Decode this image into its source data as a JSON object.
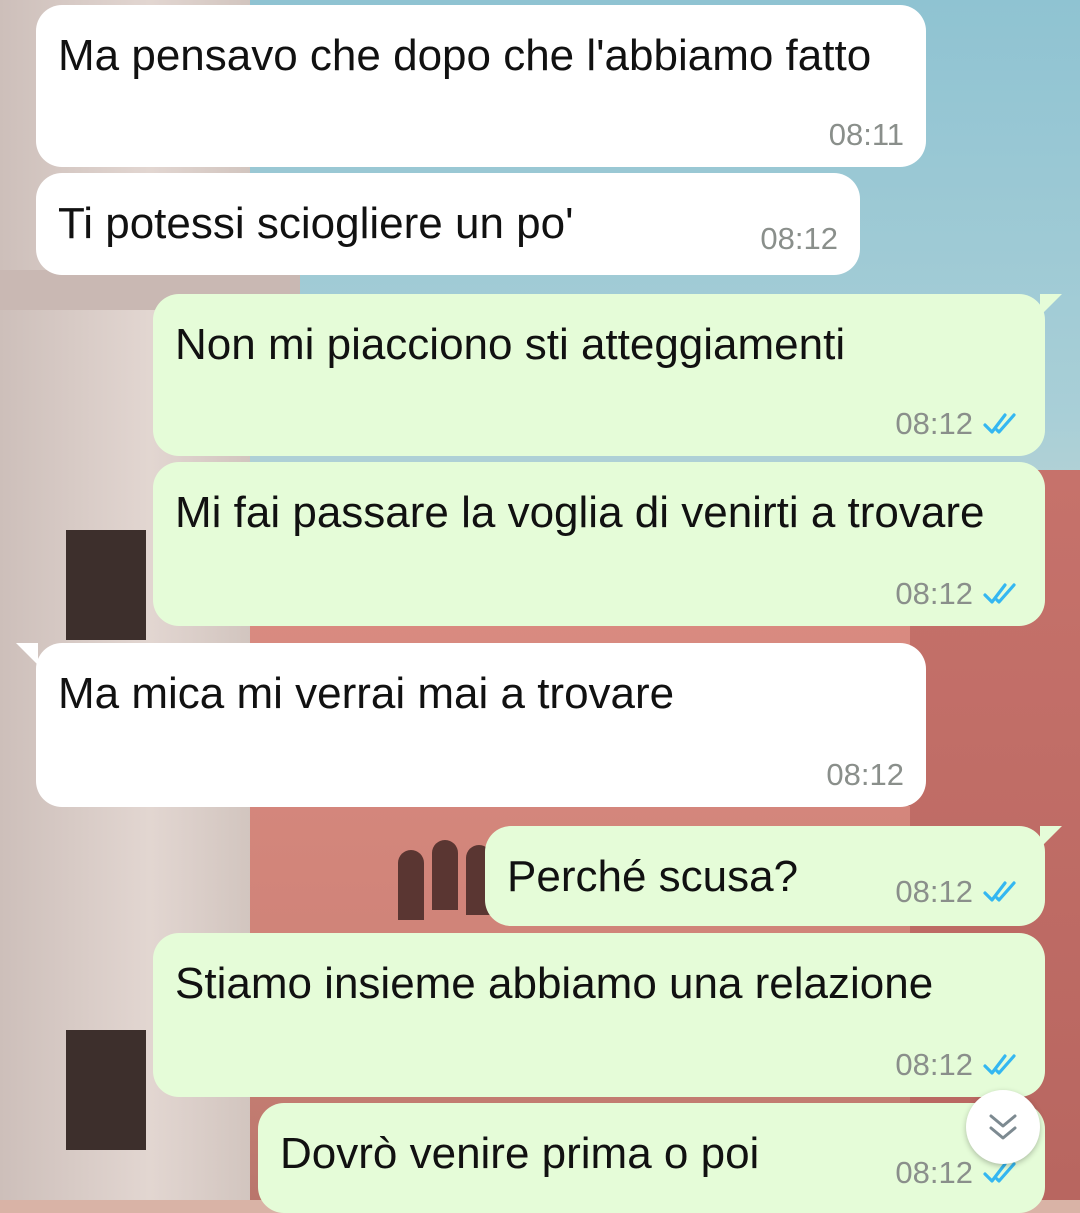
{
  "messages": [
    {
      "direction": "incoming",
      "text": "Ma pensavo che dopo che l'abbiamo fatto",
      "time": "08:11"
    },
    {
      "direction": "incoming",
      "text": "Ti potessi sciogliere un po'",
      "time": "08:12"
    },
    {
      "direction": "outgoing",
      "text": "Non mi piacciono sti atteggiamenti",
      "time": "08:12",
      "status": "read"
    },
    {
      "direction": "outgoing",
      "text": "Mi fai passare la voglia di venirti a trovare",
      "time": "08:12",
      "status": "read"
    },
    {
      "direction": "incoming",
      "text": "Ma mica mi verrai mai a trovare",
      "time": "08:12"
    },
    {
      "direction": "outgoing",
      "text": "Perché scusa?",
      "time": "08:12",
      "status": "read"
    },
    {
      "direction": "outgoing",
      "text": "Stiamo insieme abbiamo una relazione",
      "time": "08:12",
      "status": "read"
    },
    {
      "direction": "outgoing",
      "text": "Dovrò venire prima o poi",
      "time": "08:12",
      "status": "read"
    }
  ],
  "scroll_button": {
    "icon": "double-chevron-down-icon"
  },
  "colors": {
    "incoming_bubble": "#ffffff",
    "outgoing_bubble": "#e5fcd8",
    "timestamp": "#8a8f8b",
    "read_ticks": "#34b7f1"
  }
}
